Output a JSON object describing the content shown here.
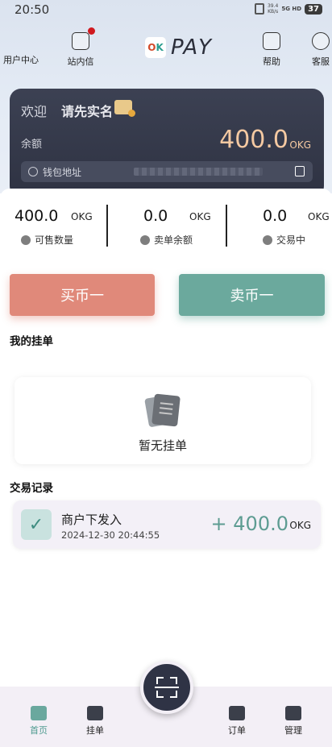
{
  "status_bar": {
    "time": "20:50",
    "net_speed": "39.4",
    "net_unit": "KB/s",
    "signal": "5G HD",
    "battery": "37"
  },
  "header": {
    "left_items": [
      {
        "label": "用户中心",
        "icon": "user-icon"
      },
      {
        "label": "站内信",
        "icon": "mail-icon",
        "has_dot": true
      }
    ],
    "logo": {
      "badge_left": "O",
      "badge_right": "K",
      "text": "PAY"
    },
    "right_items": [
      {
        "label": "帮助",
        "icon": "help-icon"
      },
      {
        "label": "客服",
        "icon": "chat-icon"
      }
    ]
  },
  "account_card": {
    "welcome": "欢迎",
    "verify_text": "请先实名",
    "balance_label": "余额",
    "balance_value": "400.0",
    "balance_unit": "OKG",
    "wallet_label": "钱包地址"
  },
  "stats": [
    {
      "value": "400.0",
      "unit": "OKG",
      "label": "可售数量"
    },
    {
      "value": "0.0",
      "unit": "OKG",
      "label": "卖单余额"
    },
    {
      "value": "0.0",
      "unit": "OKG",
      "label": "交易中"
    }
  ],
  "actions": {
    "buy_label": "买币一",
    "sell_label": "卖币一"
  },
  "my_orders": {
    "title": "我的挂单",
    "empty_text": "暂无挂单"
  },
  "transactions": {
    "title": "交易记录",
    "items": [
      {
        "title": "商户下发入",
        "time": "2024-12-30 20:44:55",
        "amount": "+ 400.0",
        "unit": "OKG"
      }
    ]
  },
  "bottom_nav": {
    "items": [
      {
        "label": "首页",
        "icon": "home-icon",
        "active": true
      },
      {
        "label": "挂单",
        "icon": "bag-icon",
        "active": false
      },
      {
        "label": "订单",
        "icon": "order-icon",
        "active": false
      },
      {
        "label": "管理",
        "icon": "card-icon",
        "active": false
      }
    ]
  },
  "colors": {
    "accent_green": "#6ba99d",
    "accent_red": "#e0897a",
    "card_dark": "#353a4b",
    "balance_gold": "#f4c9a2"
  }
}
